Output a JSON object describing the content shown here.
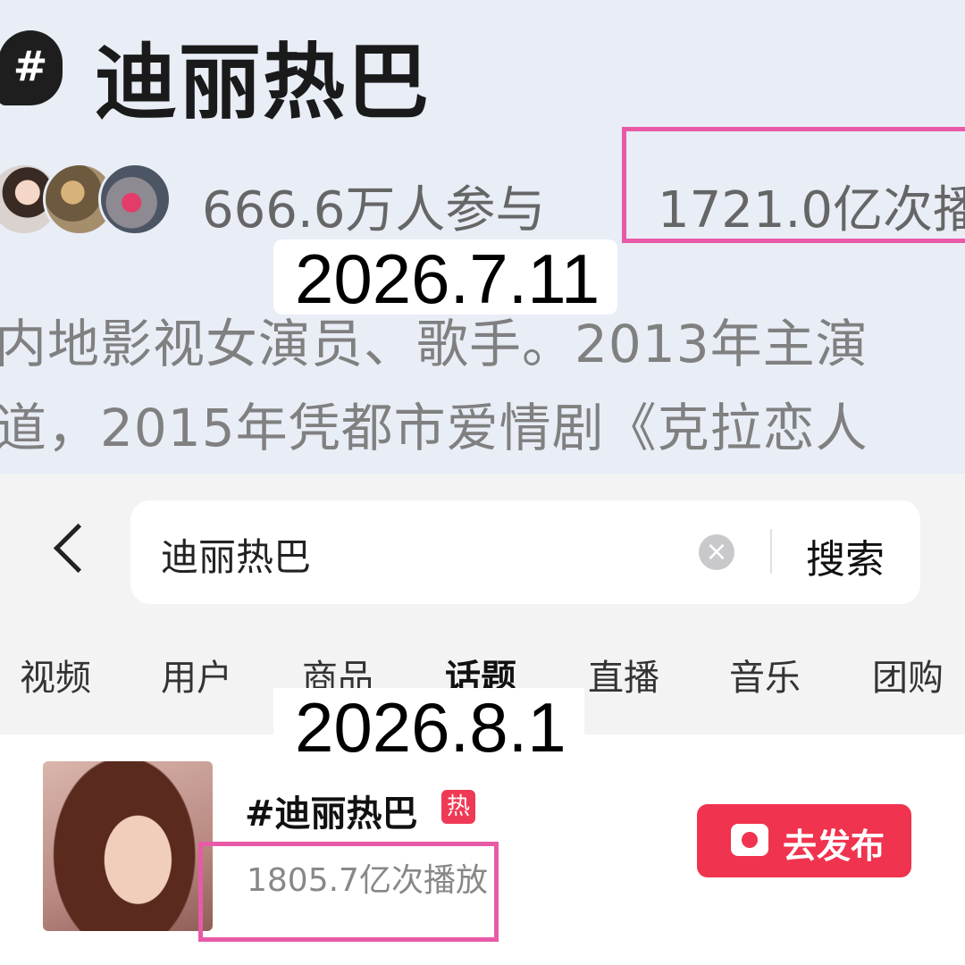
{
  "topic_page": {
    "hash_symbol": "#",
    "title": "迪丽热巴",
    "participants": "666.6万人参与",
    "plays": "1721.0亿次播",
    "date_stamp": "2026.7.11",
    "description_lines": [
      "内地影视女演员、歌手。2013年主演",
      "道，2015年凭都市爱情剧《克拉恋人"
    ]
  },
  "search_page": {
    "back_icon": "chevron-left-icon",
    "query": "迪丽热巴",
    "clear_icon": "×",
    "search_label": "搜索",
    "tabs": [
      {
        "label": "视频"
      },
      {
        "label": "用户"
      },
      {
        "label": "商品"
      },
      {
        "label": "话题"
      },
      {
        "label": "直播"
      },
      {
        "label": "音乐"
      },
      {
        "label": "团购"
      }
    ],
    "active_tab": "话题",
    "date_stamp": "2026.8.1",
    "result": {
      "title": "#迪丽热巴",
      "hot_badge": "热",
      "plays": "1805.7亿次播放",
      "publish_label": "去发布"
    }
  },
  "colors": {
    "highlight_box": "#e85aa8",
    "accent": "#f0334e",
    "top_background": "#e8edf6"
  }
}
